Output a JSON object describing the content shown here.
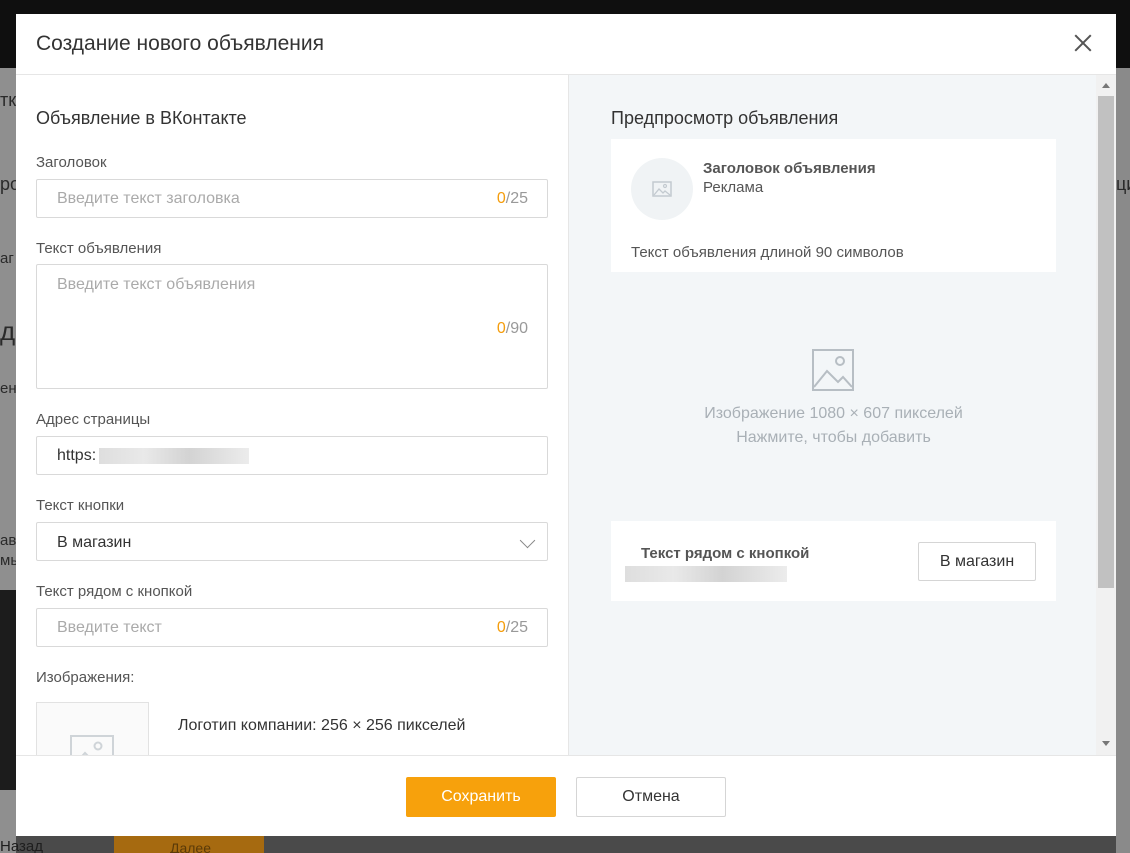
{
  "modal": {
    "title": "Создание нового объявления"
  },
  "form": {
    "section_title": "Объявление в ВКонтакте",
    "headline": {
      "label": "Заголовок",
      "placeholder": "Введите текст заголовка",
      "count": "0",
      "max": "/25"
    },
    "ad_text": {
      "label": "Текст объявления",
      "placeholder": "Введите текст объявления",
      "count": "0",
      "max": "/90"
    },
    "page_url": {
      "label": "Адрес страницы",
      "value": "https:"
    },
    "button_text": {
      "label": "Текст кнопки",
      "selected": "В магазин"
    },
    "text_near_button": {
      "label": "Текст рядом с кнопкой",
      "placeholder": "Введите текст",
      "count": "0",
      "max": "/25"
    },
    "images": {
      "label": "Изображения:",
      "logo_caption": "Логотип компании: 256 × 256 пикселей"
    }
  },
  "preview": {
    "title": "Предпросмотр объявления",
    "ad_title": "Заголовок объявления",
    "ad_subtitle": "Реклама",
    "ad_text": "Текст объявления длиной 90 символов",
    "image_line1": "Изображение 1080 × 607 пикселей",
    "image_line2": "Нажмите, чтобы добавить",
    "button_side_title": "Текст рядом с кнопкой",
    "button_label": "В магазин"
  },
  "footer": {
    "save_label": "Сохранить",
    "cancel_label": "Отмена"
  },
  "background": {
    "fragments": [
      "тк",
      "ро",
      "аг",
      "да",
      "ен",
      "ав",
      "мы",
      "ци",
      "Назад",
      "Далее"
    ]
  },
  "colors": {
    "accent": "#f7a10c",
    "counter_current": "#f59d0c"
  }
}
